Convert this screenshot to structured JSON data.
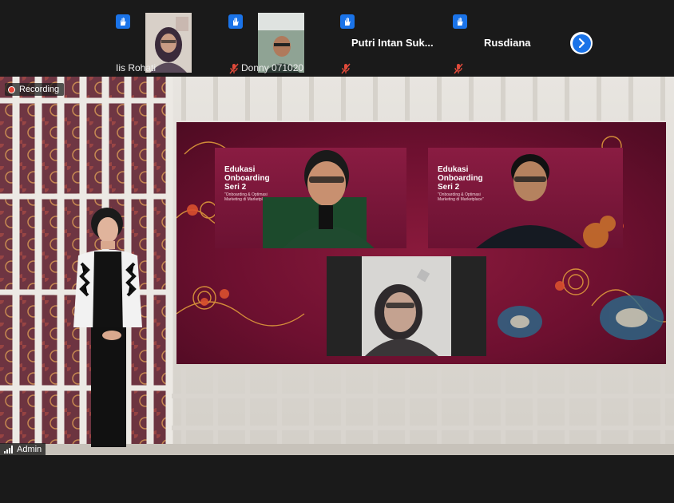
{
  "participants": [
    {
      "name": "Iis Rohati",
      "raised_hand": true,
      "video": true,
      "muted": false
    },
    {
      "name": "Donny 071020",
      "raised_hand": true,
      "video": true,
      "muted": true
    },
    {
      "name": "Putri Intan Suk...",
      "raised_hand": true,
      "video": false,
      "muted": true
    },
    {
      "name": "Rusdiana",
      "raised_hand": true,
      "video": false,
      "muted": true
    }
  ],
  "recording_label": "Recording",
  "self_view_label": "Admin",
  "shared_slides": [
    {
      "title": "Edukasi Onboarding Seri 2",
      "subtitle": "\"Onboarding & Optimasi Marketing di Marketplace\""
    },
    {
      "title": "Edukasi Onboarding Seri 2",
      "subtitle": "\"Onboarding & Optimasi Marketing di Marketplace\""
    }
  ],
  "colors": {
    "accent": "#1a73e8",
    "recording": "#e5483a",
    "batik_bg": "#6e1030"
  }
}
